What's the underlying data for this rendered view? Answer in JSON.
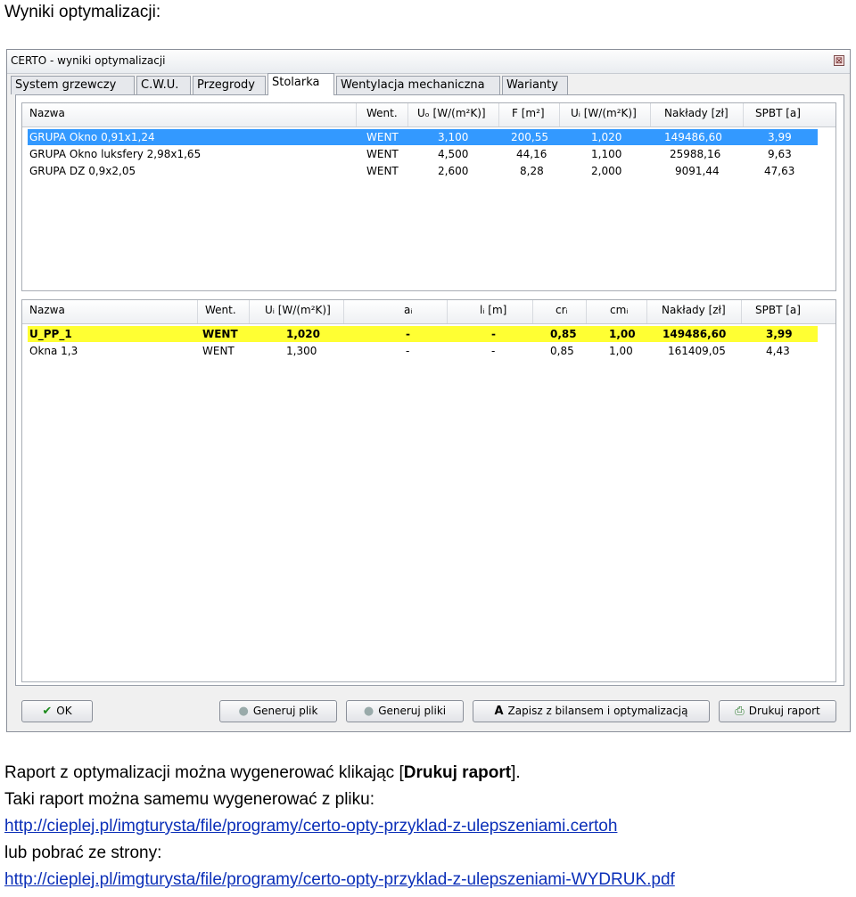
{
  "heading": "Wyniki optymalizacji:",
  "window": {
    "title": "CERTO - wyniki optymalizacji",
    "close_glyph": "⊠",
    "tabs": [
      "System grzewczy",
      "C.W.U.",
      "Przegrody",
      "Stolarka",
      "Wentylacja mechaniczna",
      "Warianty"
    ],
    "active_tab": "Stolarka"
  },
  "top_table": {
    "headers": [
      "Nazwa",
      "Went.",
      "Uₒ [W/(m²K)]",
      "F [m²]",
      "Uᵢ [W/(m²K)]",
      "Nakłady [zł]",
      "SPBT [a]"
    ],
    "rows": [
      [
        "GRUPA Okno 0,91x1,24",
        "WENT",
        "3,100",
        "200,55",
        "1,020",
        "149486,60",
        "3,99"
      ],
      [
        "GRUPA Okno luksfery 2,98x1,65",
        "WENT",
        "4,500",
        "44,16",
        "1,100",
        "25988,16",
        "9,63"
      ],
      [
        "GRUPA DZ 0,9x2,05",
        "WENT",
        "2,600",
        "8,28",
        "2,000",
        "9091,44",
        "47,63"
      ]
    ],
    "selected_row": 0
  },
  "bottom_table": {
    "headers": [
      "Nazwa",
      "Went.",
      "Uᵢ [W/(m²K)]",
      "aᵢ",
      "lᵢ [m]",
      "crᵢ",
      "cmᵢ",
      "Nakłady [zł]",
      "SPBT [a]"
    ],
    "rows": [
      [
        "U_PP_1",
        "WENT",
        "1,020",
        "-",
        "-",
        "0,85",
        "1,00",
        "149486,60",
        "3,99"
      ],
      [
        "Okna 1,3",
        "WENT",
        "1,300",
        "-",
        "-",
        "0,85",
        "1,00",
        "161409,05",
        "4,43"
      ]
    ],
    "highlighted_row": 0
  },
  "buttons": {
    "ok": "OK",
    "gen_file": "Generuj plik",
    "gen_files": "Generuj pliki",
    "save": "Zapisz z bilansem i optymalizacją",
    "print": "Drukuj raport"
  },
  "text": {
    "line1_pre": "Raport z optymalizacji można wygenerować klikając [",
    "line1_bold": "Drukuj raport",
    "line1_post": "].",
    "line2": "Taki raport można samemu wygenerować z pliku:",
    "link1": "http://cieplej.pl/imgturysta/file/programy/certo-opty-przyklad-z-ulepszeniami.certoh",
    "line3": "lub pobrać ze strony:",
    "link2": "http://cieplej.pl/imgturysta/file/programy/certo-opty-przyklad-z-ulepszeniami-WYDRUK.pdf"
  },
  "colors": {
    "selected_row": "#3399ff",
    "highlight_row": "#ffff33",
    "link": "#0b2fb8"
  }
}
